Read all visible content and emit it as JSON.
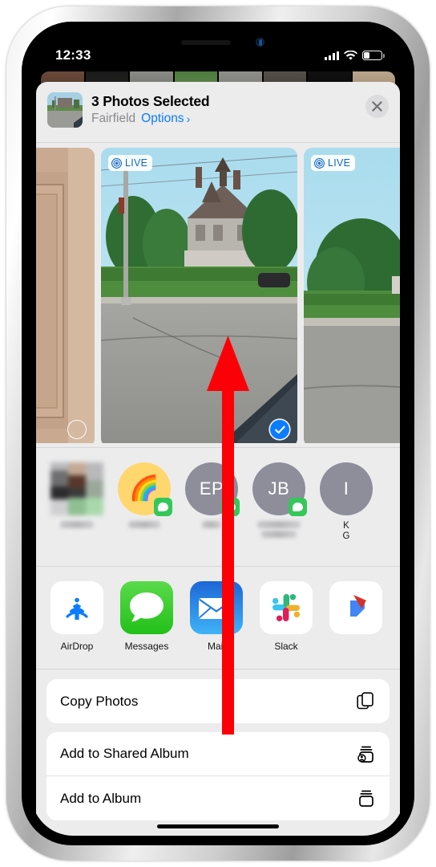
{
  "status_bar": {
    "time": "12:33",
    "cellular_icon": "cellular-bars-icon",
    "wifi_icon": "wifi-icon",
    "battery_icon": "battery-low-icon"
  },
  "share_sheet": {
    "header": {
      "title": "3 Photos Selected",
      "location": "Fairfield",
      "options_label": "Options",
      "options_chevron": "›",
      "close_icon": "close-x-icon",
      "thumbnail_name": "selected-photo-thumbnail"
    },
    "photos": [
      {
        "id": "photo-0",
        "live": false,
        "live_label": "",
        "selected": false,
        "alt": "beige-door-photo"
      },
      {
        "id": "photo-1",
        "live": true,
        "live_label": "LIVE",
        "selected": true,
        "alt": "victorian-house-street-photo"
      },
      {
        "id": "photo-2",
        "live": true,
        "live_label": "LIVE",
        "selected": true,
        "alt": "tree-street-photo"
      }
    ],
    "contacts": [
      {
        "name_blurred": true,
        "avatar_type": "photo",
        "initials": "",
        "label": "",
        "messages_badge": false
      },
      {
        "name_blurred": true,
        "avatar_type": "emoji",
        "initials": "🌈",
        "label": "",
        "messages_badge": true
      },
      {
        "name_blurred": true,
        "avatar_type": "initials",
        "initials": "EP",
        "label": "",
        "messages_badge": true
      },
      {
        "name_blurred": true,
        "avatar_type": "initials",
        "initials": "JB",
        "label": "",
        "messages_badge": true
      },
      {
        "name_blurred": false,
        "avatar_type": "initials",
        "initials": "I",
        "label": "K\nG",
        "messages_badge": false
      }
    ],
    "apps": [
      {
        "name": "AirDrop",
        "icon": "airdrop-icon"
      },
      {
        "name": "Messages",
        "icon": "messages-icon"
      },
      {
        "name": "Mail",
        "icon": "mail-icon"
      },
      {
        "name": "Slack",
        "icon": "slack-icon"
      },
      {
        "name": "",
        "icon": "partial-app-icon"
      }
    ],
    "actions": [
      {
        "label": "Copy Photos",
        "icon": "copy-icon"
      },
      {
        "label": "Add to Shared Album",
        "icon": "shared-album-icon"
      },
      {
        "label": "Add to Album",
        "icon": "album-icon"
      }
    ]
  },
  "annotation": {
    "arrow_color": "#fb0007",
    "arrow_direction": "up",
    "arrow_name": "swipe-up-arrow"
  },
  "colors": {
    "accent_blue": "#0a7cff",
    "live_blue": "#1268c3",
    "sheet_bg": "#ececed",
    "row_bg": "#ffffff",
    "messages_green": "#34c759"
  }
}
